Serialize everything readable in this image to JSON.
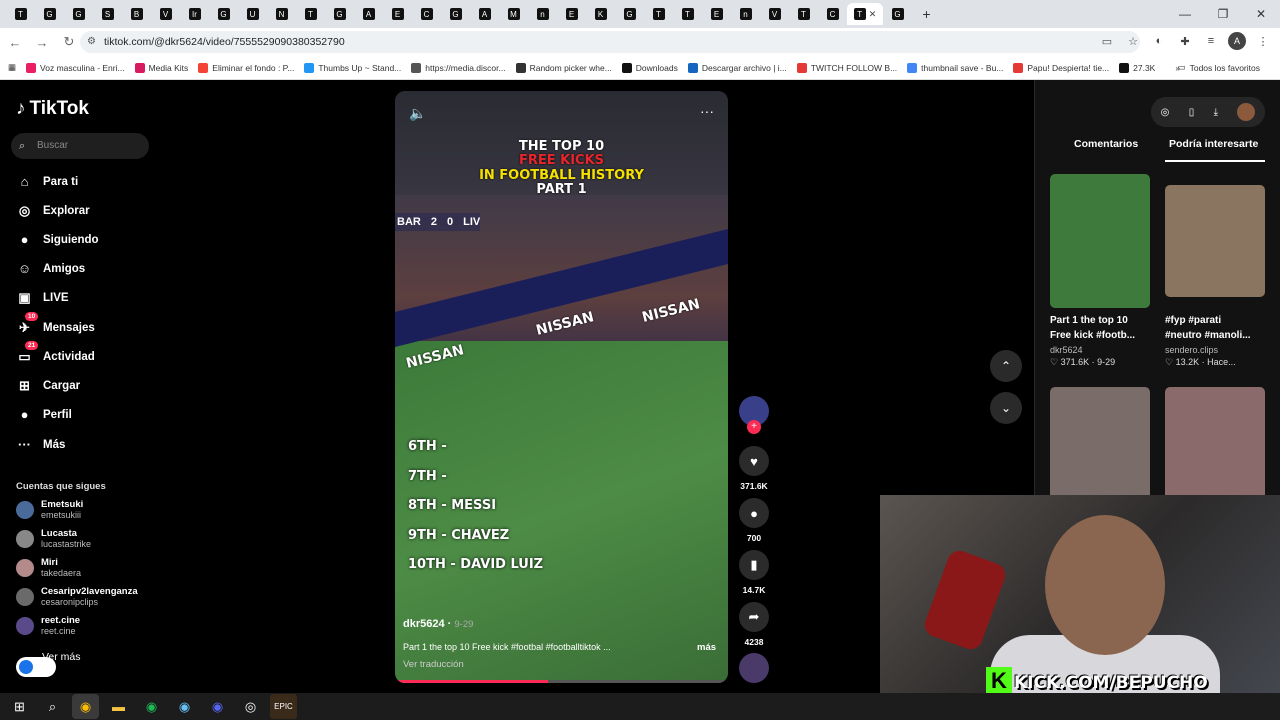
{
  "browser": {
    "tabs": [
      "T",
      "G",
      "G",
      "S",
      "B",
      "V",
      "Ir",
      "G",
      "U",
      "N",
      "T",
      "G",
      "A",
      "E",
      "C",
      "G",
      "A",
      "M",
      "n",
      "E",
      "K",
      "G",
      "T",
      "T",
      "E",
      "n",
      "V",
      "T",
      "C",
      "T",
      "G"
    ],
    "active_tab_index": 29,
    "url": "tiktok.com/@dkr5624/video/7555529090380352790",
    "account_initial": "A",
    "bookmarks": [
      {
        "label": "Voz masculina - Enri...",
        "color": "#e91e63"
      },
      {
        "label": "Media Kits",
        "color": "#d81b60"
      },
      {
        "label": "Eliminar el fondo : P...",
        "color": "#f44336"
      },
      {
        "label": "Thumbs Up ~ Stand...",
        "color": "#2196f3"
      },
      {
        "label": "https://media.discor...",
        "color": "#555"
      },
      {
        "label": "Random picker whe...",
        "color": "#333"
      },
      {
        "label": "Downloads",
        "color": "#111"
      },
      {
        "label": "Descargar archivo | i...",
        "color": "#1565c0"
      },
      {
        "label": "TWITCH FOLLOW B...",
        "color": "#e53935"
      },
      {
        "label": "thumbnail save - Bu...",
        "color": "#4285f4"
      },
      {
        "label": "Papu! Despierta! tie...",
        "color": "#e53935"
      },
      {
        "label": "27.3K",
        "color": "#111"
      }
    ],
    "all_bookmarks": "Todos los favoritos"
  },
  "tiktok": {
    "logo": "TikTok",
    "search_placeholder": "Buscar",
    "nav": [
      {
        "label": "Para ti",
        "icon": "home-icon",
        "glyph": "⌂"
      },
      {
        "label": "Explorar",
        "icon": "compass-icon",
        "glyph": "◎"
      },
      {
        "label": "Siguiendo",
        "icon": "following-avatar-icon",
        "glyph": "●"
      },
      {
        "label": "Amigos",
        "icon": "friends-icon",
        "glyph": "☺"
      },
      {
        "label": "LIVE",
        "icon": "live-icon",
        "glyph": "▣"
      },
      {
        "label": "Mensajes",
        "icon": "messages-icon",
        "glyph": "✈",
        "badge": "10"
      },
      {
        "label": "Actividad",
        "icon": "activity-icon",
        "glyph": "▭",
        "badge": "21"
      },
      {
        "label": "Cargar",
        "icon": "upload-icon",
        "glyph": "⊞"
      },
      {
        "label": "Perfil",
        "icon": "profile-icon",
        "glyph": "●"
      },
      {
        "label": "Más",
        "icon": "more-icon",
        "glyph": "···"
      }
    ],
    "following_title": "Cuentas que sigues",
    "following": [
      {
        "name": "Emetsuki",
        "handle": "emetsukiii"
      },
      {
        "name": "Lucasta",
        "handle": "lucastastrike"
      },
      {
        "name": "Miri",
        "handle": "takedaera"
      },
      {
        "name": "Cesaripv2lavenganza",
        "handle": "cesaronipclips"
      },
      {
        "name": "reet.cine",
        "handle": "reet.cine"
      }
    ],
    "ver_mas": "Ver más"
  },
  "video": {
    "title_lines": [
      "THE TOP 10",
      "FREE KICKS",
      "IN FOOTBALL HISTORY",
      "PART 1"
    ],
    "score": {
      "home": "BAR",
      "home_goals": "2",
      "away_goals": "0",
      "away": "LIV"
    },
    "banner_text": "NISSAN",
    "ranking": [
      "6TH -",
      "7TH -",
      "8TH - MESSI",
      "9TH - CHAVEZ",
      "10TH - DAVID LUIZ"
    ],
    "author": "dkr5624",
    "date": "9-29",
    "caption": "Part 1 the top 10 Free kick #footbal #footballtiktok ...",
    "more": "más",
    "translate": "Ver traducción",
    "progress": 0.46
  },
  "actions": {
    "likes": "371.6K",
    "comments": "700",
    "saves": "14.7K",
    "shares": "4238"
  },
  "panel": {
    "tab_comments": "Comentarios",
    "tab_interest": "Podría interesarte",
    "cards": [
      {
        "title_1": "Part 1 the top 10",
        "title_2": "Free kick #footb...",
        "user": "dkr5624",
        "stats": "♡ 371.6K · 9-29",
        "color": "#3e7a3b"
      },
      {
        "title_1": "#fyp #parati",
        "title_2": "#neutro #manoli...",
        "user": "sendero.clips",
        "stats": "♡ 13.2K · Hace...",
        "color": "#8a7560"
      },
      {
        "color": "#7a6c68"
      },
      {
        "color": "#8a6a6a"
      }
    ]
  },
  "stream_overlay": "KICK.COM/BEPUCHO"
}
